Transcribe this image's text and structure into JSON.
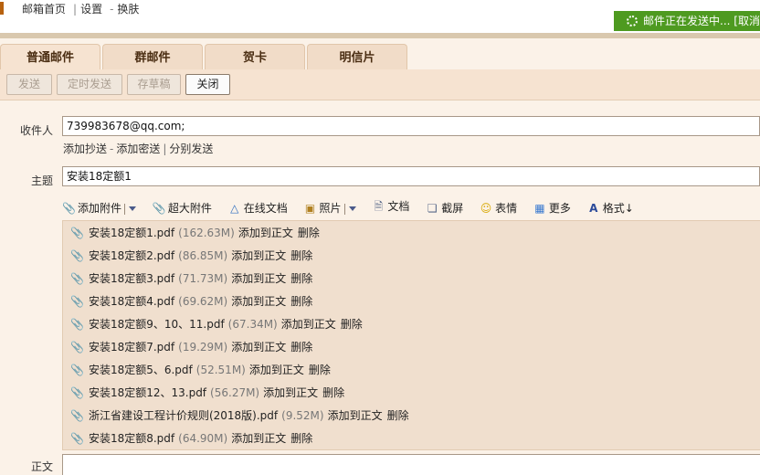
{
  "topbar": {
    "links": [
      "邮箱首页",
      "设置",
      "换肤"
    ],
    "link_separator": "|",
    "link_dash": "-",
    "status": "邮件正在发送中... [取消]"
  },
  "tabs": [
    "普通邮件",
    "群邮件",
    "贺卡",
    "明信片"
  ],
  "toolbar": {
    "send": "发送",
    "scheduled_send": "定时发送",
    "save_draft": "存草稿",
    "close": "关闭"
  },
  "form": {
    "recipient_label": "收件人",
    "recipient_value": "739983678@qq.com;",
    "add_cc": "添加抄送",
    "add_bcc": "添加密送",
    "separate_send": "分别发送",
    "subject_label": "主题",
    "subject_value": "安装18定额1",
    "body_label": "正文"
  },
  "attach_toolbar": {
    "add_attachment": "添加附件",
    "large_attachment": "超大附件",
    "online_doc": "在线文档",
    "photo": "照片",
    "document": "文档",
    "screenshot": "截屏",
    "emoji": "表情",
    "more": "更多",
    "format": "格式↓"
  },
  "attachment_actions": {
    "add_to_body": "添加到正文",
    "delete": "删除"
  },
  "attachments": [
    {
      "name": "安装18定额1.pdf",
      "size": "(162.63M)"
    },
    {
      "name": "安装18定额2.pdf",
      "size": "(86.85M)"
    },
    {
      "name": "安装18定额3.pdf",
      "size": "(71.73M)"
    },
    {
      "name": "安装18定额4.pdf",
      "size": "(69.62M)"
    },
    {
      "name": "安装18定额9、10、11.pdf",
      "size": "(67.34M)"
    },
    {
      "name": "安装18定额7.pdf",
      "size": "(19.29M)"
    },
    {
      "name": "安装18定额5、6.pdf",
      "size": "(52.51M)"
    },
    {
      "name": "安装18定额12、13.pdf",
      "size": "(56.27M)"
    },
    {
      "name": "浙江省建设工程计价规则(2018版).pdf",
      "size": "(9.52M)"
    },
    {
      "name": "安装18定额8.pdf",
      "size": "(64.90M)"
    }
  ]
}
